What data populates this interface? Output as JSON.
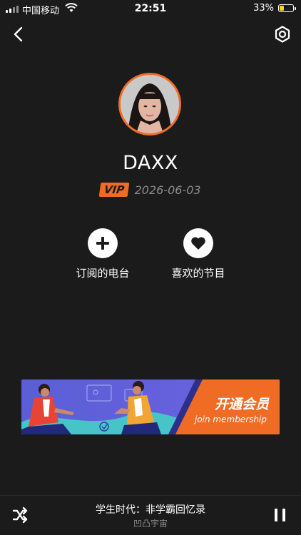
{
  "status_bar": {
    "carrier": "中国移动",
    "time": "22:51",
    "battery_percent": "33%",
    "battery_level": 0.33
  },
  "nav": {
    "back_icon": "chevron-left-icon",
    "settings_icon": "gear-icon"
  },
  "profile": {
    "username": "DAXX",
    "vip_label": "VIP",
    "vip_expiry": "2026-06-03"
  },
  "actions": [
    {
      "label": "订阅的电台",
      "icon": "plus-icon"
    },
    {
      "label": "喜欢的节目",
      "icon": "heart-icon"
    }
  ],
  "banner": {
    "title": "开通会员",
    "subtitle": "join membership",
    "accent_color": "#f06c25"
  },
  "player": {
    "track_title": "学生时代：非学霸回忆录",
    "artist": "凹凸宇宙",
    "shuffle_icon": "shuffle-icon",
    "pause_icon": "pause-icon"
  },
  "colors": {
    "background": "#1b1b1b",
    "accent": "#f06c25",
    "muted_text": "#8c8c8c"
  }
}
